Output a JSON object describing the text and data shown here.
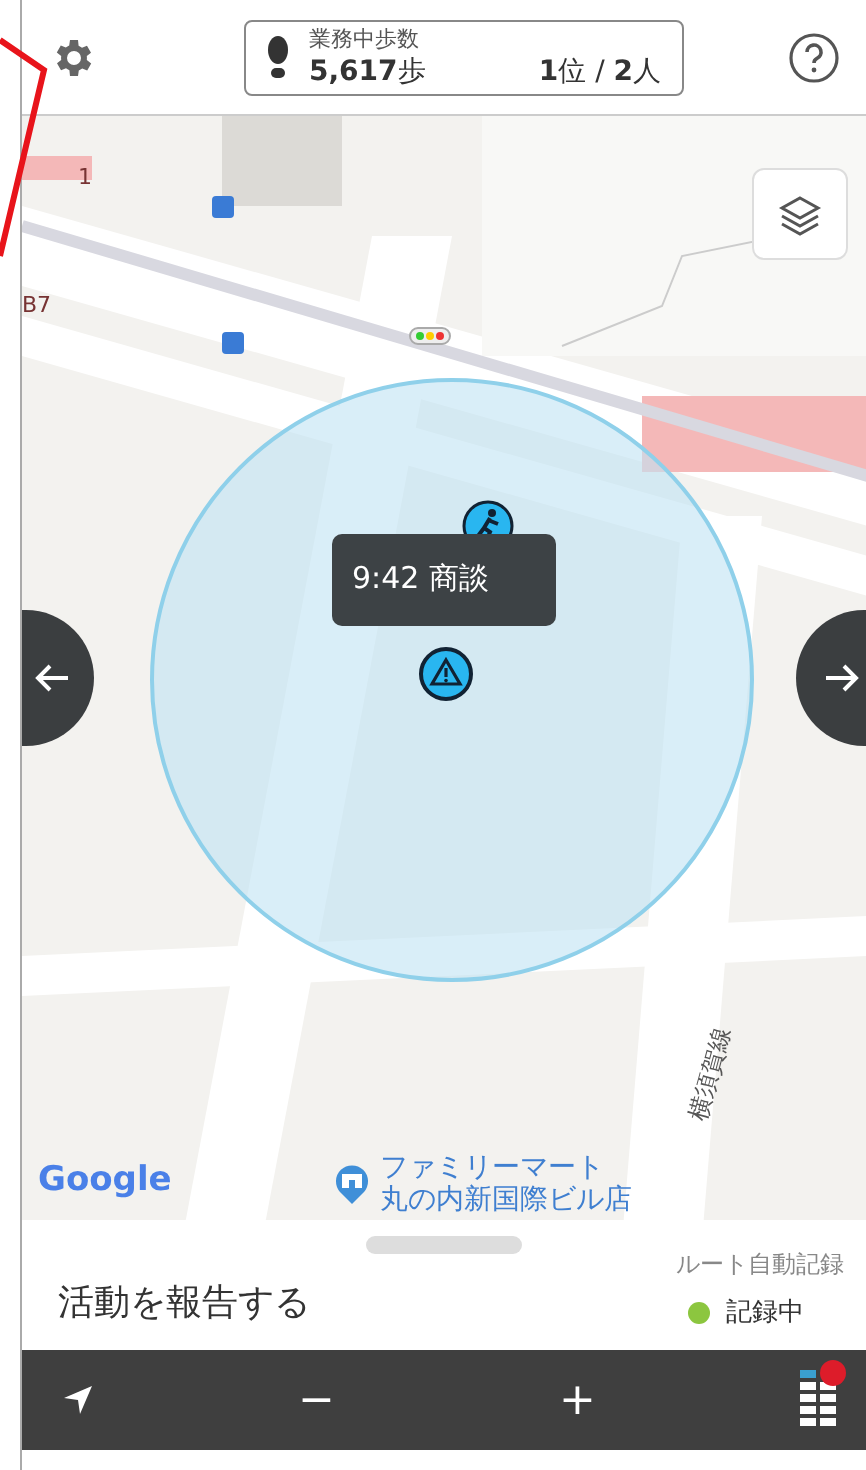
{
  "header": {
    "steps_label": "業務中歩数",
    "steps": "**5,617**歩",
    "rank": "**1**位 / **2**人"
  },
  "map": {
    "labels": [
      {
        "text": "1"
      },
      {
        "text": "B7"
      }
    ],
    "tooltip": "9:42 商談",
    "attribution": "Google",
    "poi": [
      "ファミリーマート",
      "丸の内新国際ビル店"
    ],
    "rail_label": "横須賀線"
  },
  "sheet": {
    "title": "活動を報告する",
    "route_label": "ルート自動記録",
    "status": "記録中",
    "recording": true
  },
  "toolbar": {
    "minus": "−",
    "plus": "+",
    "notification": true
  }
}
